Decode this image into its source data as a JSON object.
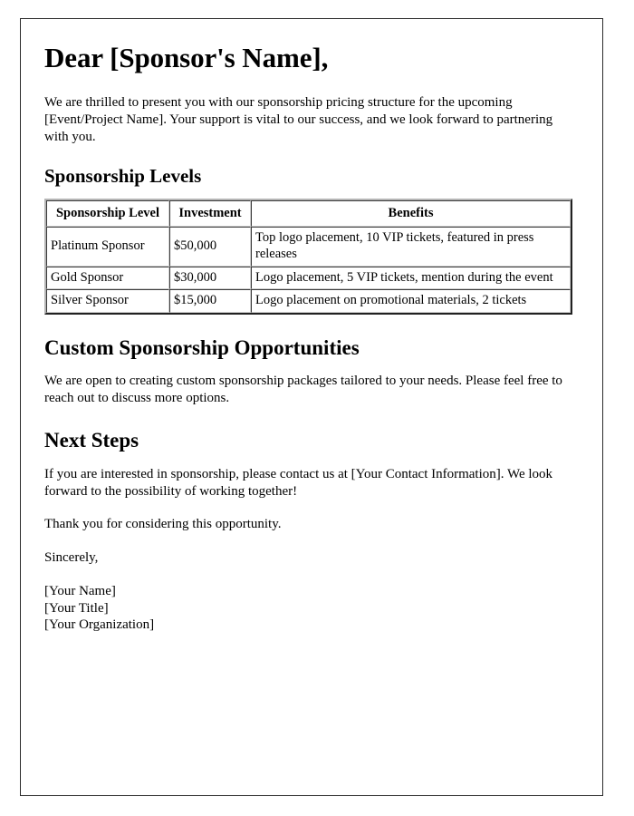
{
  "document": {
    "title": "Dear [Sponsor's Name],",
    "intro_paragraph": "We are thrilled to present you with our sponsorship pricing structure for the upcoming [Event/Project Name]. Your support is vital to our success, and we look forward to partnering with you.",
    "sections": {
      "sponsorship_levels": {
        "heading": "Sponsorship Levels"
      },
      "custom_opportunities": {
        "heading": "Custom Sponsorship Opportunities",
        "paragraph": "We are open to creating custom sponsorship packages tailored to your needs. Please feel free to reach out to discuss more options."
      },
      "next_steps": {
        "heading": "Next Steps",
        "paragraph": "If you are interested in sponsorship, please contact us at [Your Contact Information]. We look forward to the possibility of working together!"
      }
    },
    "closing": {
      "thanks": "Thank you for considering this opportunity.",
      "sign_off": "Sincerely,",
      "signature_lines": [
        "[Your Name]",
        "[Your Title]",
        "[Your Organization]"
      ]
    }
  },
  "table": {
    "headers": {
      "level": "Sponsorship Level",
      "investment": "Investment",
      "benefits": "Benefits"
    },
    "rows": [
      {
        "level": "Platinum Sponsor",
        "investment": "$50,000",
        "benefits": "Top logo placement, 10 VIP tickets, featured in press releases"
      },
      {
        "level": "Gold Sponsor",
        "investment": "$30,000",
        "benefits": "Logo placement, 5 VIP tickets, mention during the event"
      },
      {
        "level": "Silver Sponsor",
        "investment": "$15,000",
        "benefits": "Logo placement on promotional materials, 2 tickets"
      }
    ]
  },
  "theme": {
    "page_border_color": "#2b2b2b",
    "text_color": "#000000",
    "background_color": "#ffffff",
    "table_border_color": "#9a9a9a"
  }
}
